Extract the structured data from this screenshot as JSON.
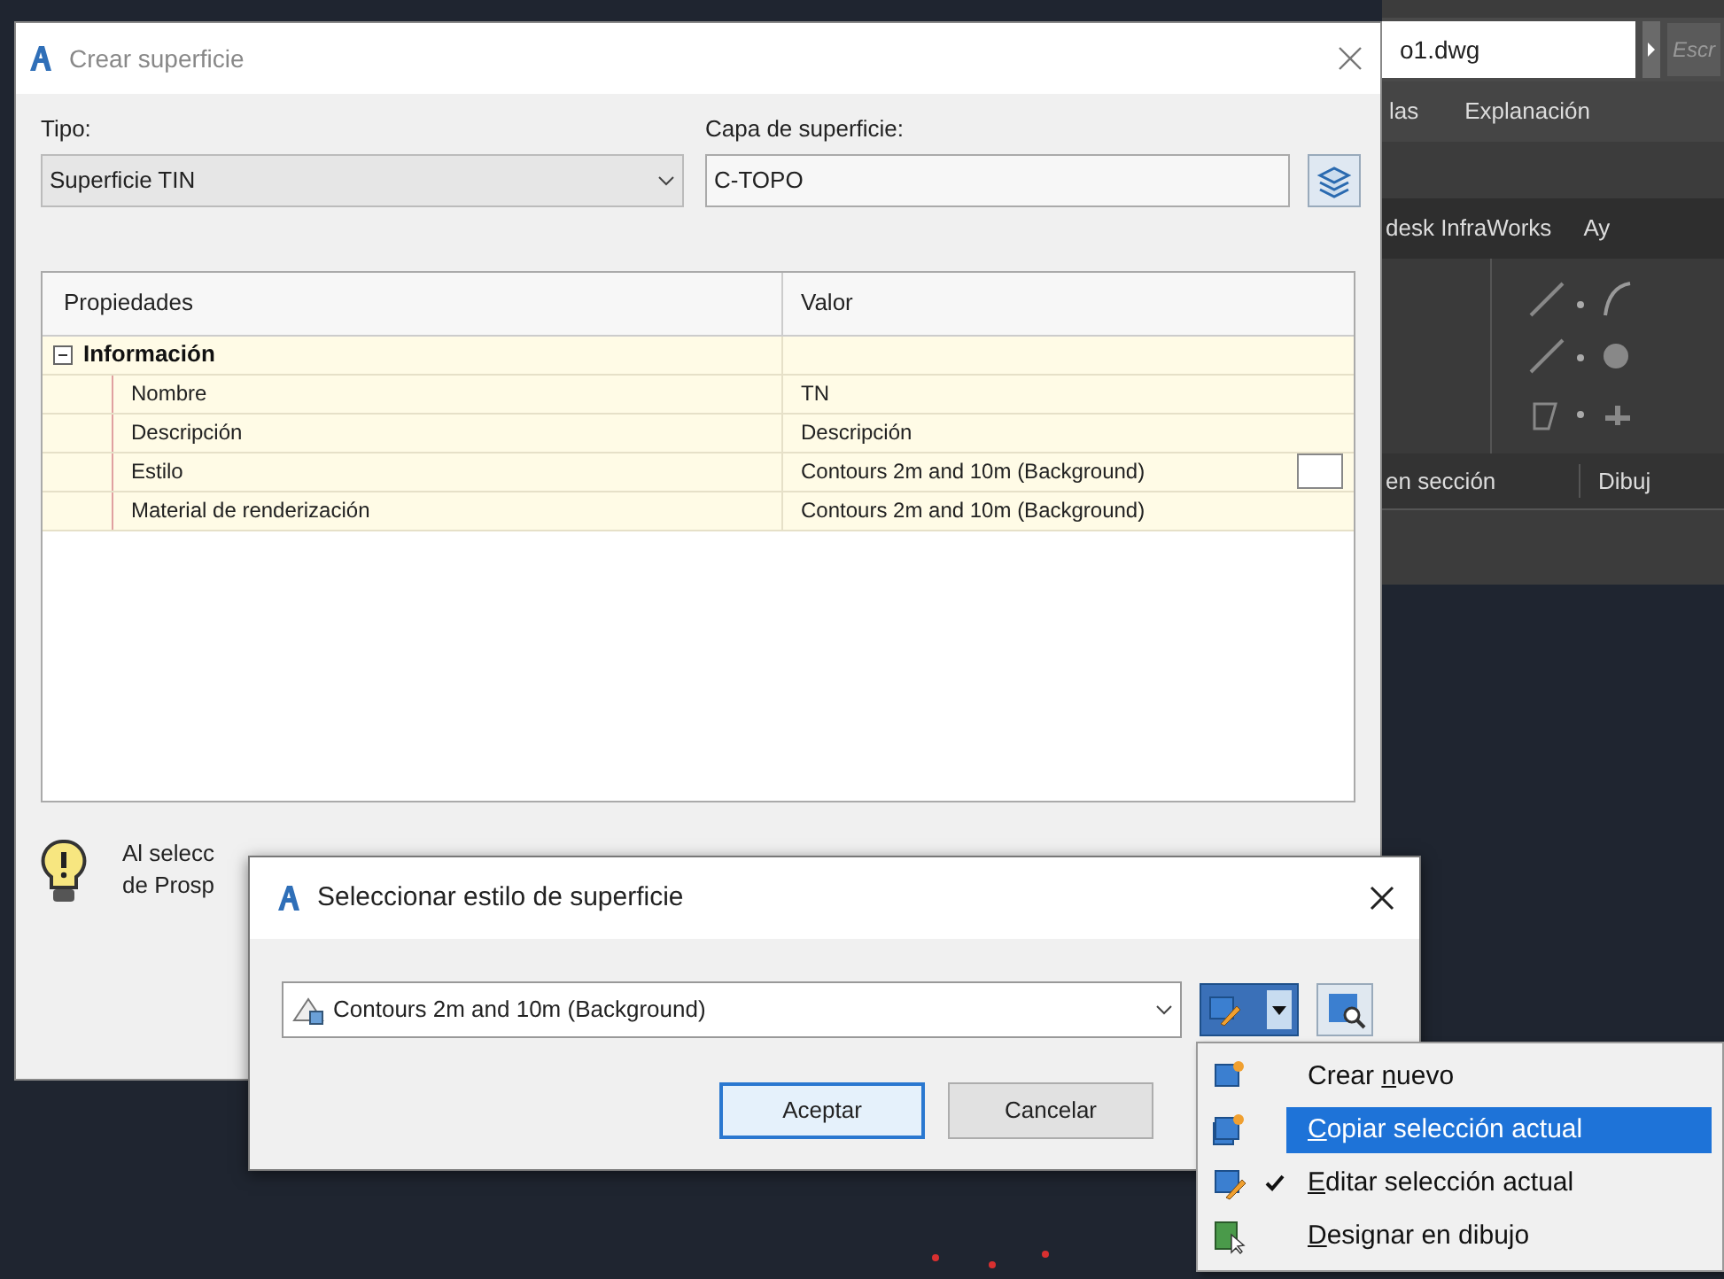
{
  "background_app": {
    "file_name": "o1.dwg",
    "search_placeholder": "Escr",
    "ribbon_tabs": [
      "las",
      "Explanación"
    ],
    "ribbon_tabs_2": [
      "desk InfraWorks",
      "Ay"
    ],
    "panel_labels": [
      "en sección",
      "Dibuj"
    ]
  },
  "create_dialog": {
    "title": "Crear superficie",
    "type_label": "Tipo:",
    "type_value": "Superficie TIN",
    "layer_label": "Capa de superficie:",
    "layer_value": "C-TOPO",
    "grid": {
      "columns": [
        "Propiedades",
        "Valor"
      ],
      "group": {
        "name": "Información",
        "expanded": true
      },
      "rows": [
        {
          "property": "Nombre",
          "value": "TN",
          "kind": "text"
        },
        {
          "property": "Descripción",
          "value": "Descripción",
          "kind": "text"
        },
        {
          "property": "Estilo",
          "value": "Contours 2m and 10m (Background)",
          "kind": "picker"
        },
        {
          "property": "Material de renderización",
          "value": "Contours 2m and 10m (Background)",
          "kind": "text"
        }
      ]
    },
    "hint_lines": [
      "Al selecc",
      "de Prosp"
    ]
  },
  "style_dialog": {
    "title": "Seleccionar estilo de superficie",
    "style_value": "Contours 2m and 10m (Background)",
    "buttons": [
      {
        "label": "Aceptar",
        "default": true
      },
      {
        "label": "Cancelar",
        "default": false
      }
    ]
  },
  "menu": {
    "items": [
      {
        "before": "Crear ",
        "key": "n",
        "after": "uevo",
        "selected": false,
        "checked": false
      },
      {
        "key": "C",
        "after": "opiar selección actual",
        "selected": true,
        "checked": false
      },
      {
        "key": "E",
        "after": "ditar selección actual",
        "selected": false,
        "checked": true
      },
      {
        "key": "D",
        "after": "esignar en dibujo",
        "selected": false,
        "checked": false
      }
    ]
  }
}
